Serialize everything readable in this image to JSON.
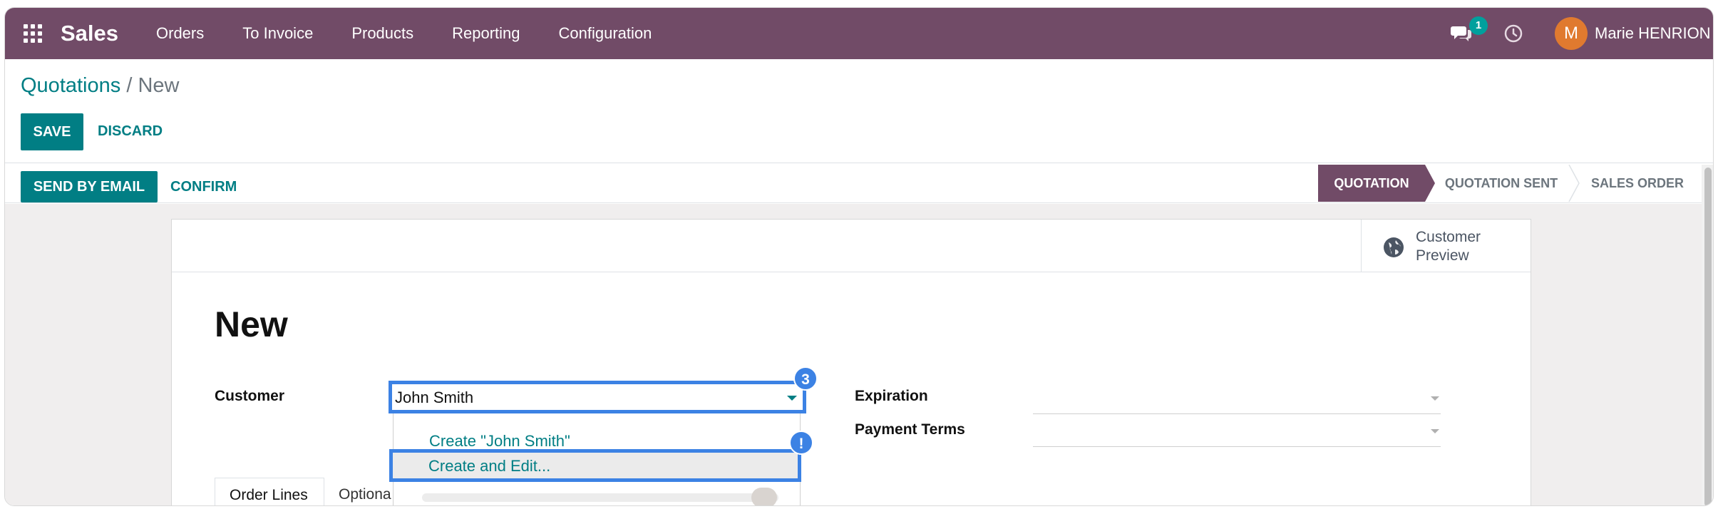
{
  "navbar": {
    "app_name": "Sales",
    "menu": [
      "Orders",
      "To Invoice",
      "Products",
      "Reporting",
      "Configuration"
    ],
    "message_count": "1",
    "user_initial": "M",
    "user_name": "Marie HENRION",
    "color": "#714b67"
  },
  "breadcrumb": {
    "parent": "Quotations",
    "separator": "/",
    "current": "New"
  },
  "control": {
    "save_label": "SAVE",
    "discard_label": "DISCARD"
  },
  "statusbar": {
    "send_label": "SEND BY EMAIL",
    "confirm_label": "CONFIRM",
    "stages": [
      "QUOTATION",
      "QUOTATION SENT",
      "SALES ORDER"
    ],
    "active_stage": "QUOTATION"
  },
  "sheet": {
    "preview_label": "Customer Preview",
    "title": "New",
    "customer_label": "Customer",
    "customer_value": "John Smith",
    "expiration_label": "Expiration",
    "payment_terms_label": "Payment Terms",
    "dropdown": {
      "create_option": "Create \"John Smith\"",
      "create_edit_option": "Create and Edit..."
    },
    "tabs": [
      "Order Lines",
      "Optiona"
    ]
  },
  "guide": {
    "step_marker": "3",
    "alert_marker": "!",
    "color": "#3c82e4"
  },
  "accent_color": "#017e84"
}
